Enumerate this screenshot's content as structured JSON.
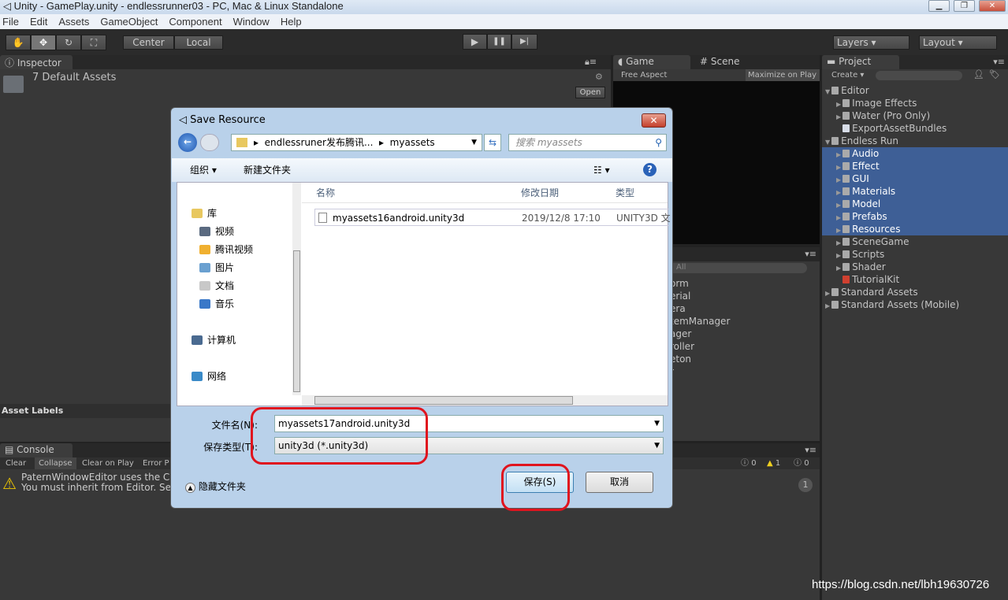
{
  "window": {
    "title": "Unity - GamePlay.unity - endlessrunner03 - PC, Mac & Linux Standalone",
    "min": "▁",
    "max": "❐",
    "close": "✕"
  },
  "menu": [
    "File",
    "Edit",
    "Assets",
    "GameObject",
    "Component",
    "Window",
    "Help"
  ],
  "toolbar": {
    "tools": [
      "hand-tool",
      "move-tool",
      "rotate-tool",
      "scale-tool"
    ],
    "tool_glyphs": [
      "✋",
      "✥",
      "↻",
      "⛶"
    ],
    "pivot": "Center",
    "space": "Local",
    "play": "▶",
    "pause": "❚❚",
    "step": "▶|",
    "layers": "Layers",
    "layout": "Layout"
  },
  "inspector": {
    "tab": "Inspector",
    "title": "7 Default Assets",
    "open": "Open",
    "asset_labels": "Asset Labels"
  },
  "game": {
    "tab_game": "Game",
    "tab_scene": "Scene",
    "aspect": "Free Aspect",
    "maximize": "Maximize on Play"
  },
  "hierarchy": {
    "search": "All",
    "items": [
      "orm",
      "erial",
      "era",
      "temManager",
      "ager",
      "roller",
      "eton",
      "r"
    ]
  },
  "project": {
    "tab": "Project",
    "create": "Create",
    "items": [
      {
        "label": "Editor",
        "depth": 0,
        "open": true,
        "sel": false
      },
      {
        "label": "Image Effects",
        "depth": 1,
        "sel": false
      },
      {
        "label": "Water (Pro Only)",
        "depth": 1,
        "sel": false
      },
      {
        "label": "ExportAssetBundles",
        "depth": 1,
        "sel": false,
        "script": true
      },
      {
        "label": "Endless Run",
        "depth": 0,
        "open": true,
        "sel": false
      },
      {
        "label": "Audio",
        "depth": 1,
        "sel": true
      },
      {
        "label": "Effect",
        "depth": 1,
        "sel": true
      },
      {
        "label": "GUI",
        "depth": 1,
        "sel": true
      },
      {
        "label": "Materials",
        "depth": 1,
        "sel": true
      },
      {
        "label": "Model",
        "depth": 1,
        "sel": true
      },
      {
        "label": "Prefabs",
        "depth": 1,
        "sel": true
      },
      {
        "label": "Resources",
        "depth": 1,
        "sel": true
      },
      {
        "label": "SceneGame",
        "depth": 1,
        "sel": false
      },
      {
        "label": "Scripts",
        "depth": 1,
        "sel": false
      },
      {
        "label": "Shader",
        "depth": 1,
        "sel": false
      },
      {
        "label": "TutorialKit",
        "depth": 1,
        "sel": false,
        "script": true
      },
      {
        "label": "Standard Assets",
        "depth": 0,
        "sel": false
      },
      {
        "label": "Standard Assets (Mobile)",
        "depth": 0,
        "sel": false
      }
    ]
  },
  "console": {
    "tab": "Console",
    "buttons": [
      "Clear",
      "Collapse",
      "Clear on Play",
      "Error P"
    ],
    "line1": "PaternWindowEditor uses the Cus",
    "line2": "You must inherit from Editor. See",
    "counts": {
      "info": "0",
      "warn": "1",
      "error": "0"
    },
    "badge": "1"
  },
  "dialog": {
    "title": "Save Resource",
    "path": [
      "endlessruner发布腾讯...",
      "myassets"
    ],
    "search_placeholder": "搜索 myassets",
    "organize": "组织 ▾",
    "new_folder": "新建文件夹",
    "nav": [
      {
        "label": "库",
        "icon": "library-icon",
        "indent": 0
      },
      {
        "label": "视频",
        "icon": "video-icon",
        "indent": 1
      },
      {
        "label": "腾讯视频",
        "icon": "folder-icon",
        "indent": 1
      },
      {
        "label": "图片",
        "icon": "pictures-icon",
        "indent": 1
      },
      {
        "label": "文档",
        "icon": "documents-icon",
        "indent": 1
      },
      {
        "label": "音乐",
        "icon": "music-icon",
        "indent": 1
      },
      {
        "label": "计算机",
        "icon": "computer-icon",
        "indent": 0
      },
      {
        "label": "网络",
        "icon": "network-icon",
        "indent": 0
      }
    ],
    "columns": [
      "名称",
      "修改日期",
      "类型"
    ],
    "files": [
      {
        "name": "myassets16android.unity3d",
        "date": "2019/12/8 17:10",
        "type": "UNITY3D 文"
      }
    ],
    "filename_label": "文件名(N):",
    "filename": "myassets17android.unity3d",
    "filetype_label": "保存类型(T):",
    "filetype": "unity3d (*.unity3d)",
    "hide_folders": "隐藏文件夹",
    "save": "保存(S)",
    "cancel": "取消"
  },
  "watermark": "https://blog.csdn.net/lbh19630726"
}
